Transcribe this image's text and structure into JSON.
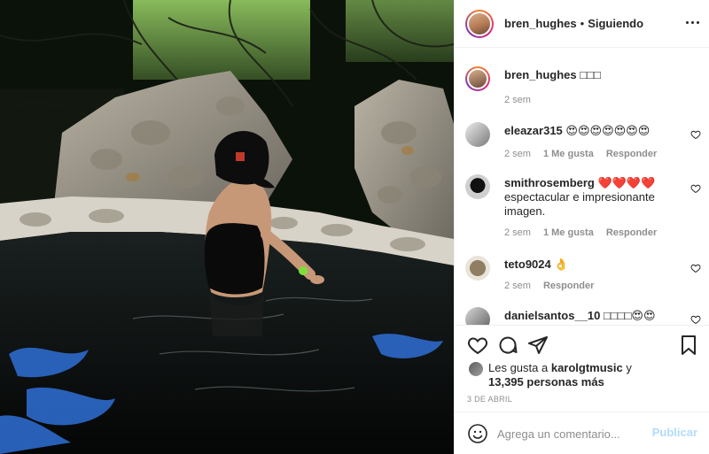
{
  "photo": {
    "subject": "person in black swimsuit and black cap standing in a stone pool of dark water"
  },
  "header": {
    "username": "bren_hughes",
    "separator": "•",
    "follow_status": "Siguiendo"
  },
  "caption": {
    "username": "bren_hughes",
    "text": "□□□",
    "time": "2 sem"
  },
  "comments": [
    {
      "username": "eleazar315",
      "text": "😍😍😍😍😍😍😍",
      "time": "2 sem",
      "likes": "1 Me gusta",
      "reply": "Responder"
    },
    {
      "username": "smithrosemberg",
      "text": "❤️❤️❤️❤️ espectacular e impresionante imagen.",
      "time": "2 sem",
      "likes": "1 Me gusta",
      "reply": "Responder"
    },
    {
      "username": "teto9024",
      "text": "👌",
      "time": "2 sem",
      "likes": "",
      "reply": "Responder"
    },
    {
      "username": "danielsantos__10",
      "text": "□□□□😍😍"
    }
  ],
  "likes": {
    "prefix": "Les gusta a",
    "user": "karolgtmusic",
    "connector": "y",
    "count": "13,395 personas más"
  },
  "date": "3 DE ABRIL",
  "add_comment": {
    "placeholder": "Agrega un comentario...",
    "post_label": "Publicar"
  },
  "colors": {
    "post_disabled": "#b3dbff",
    "secondary_text": "#8e8e8e",
    "border": "#efefef"
  }
}
